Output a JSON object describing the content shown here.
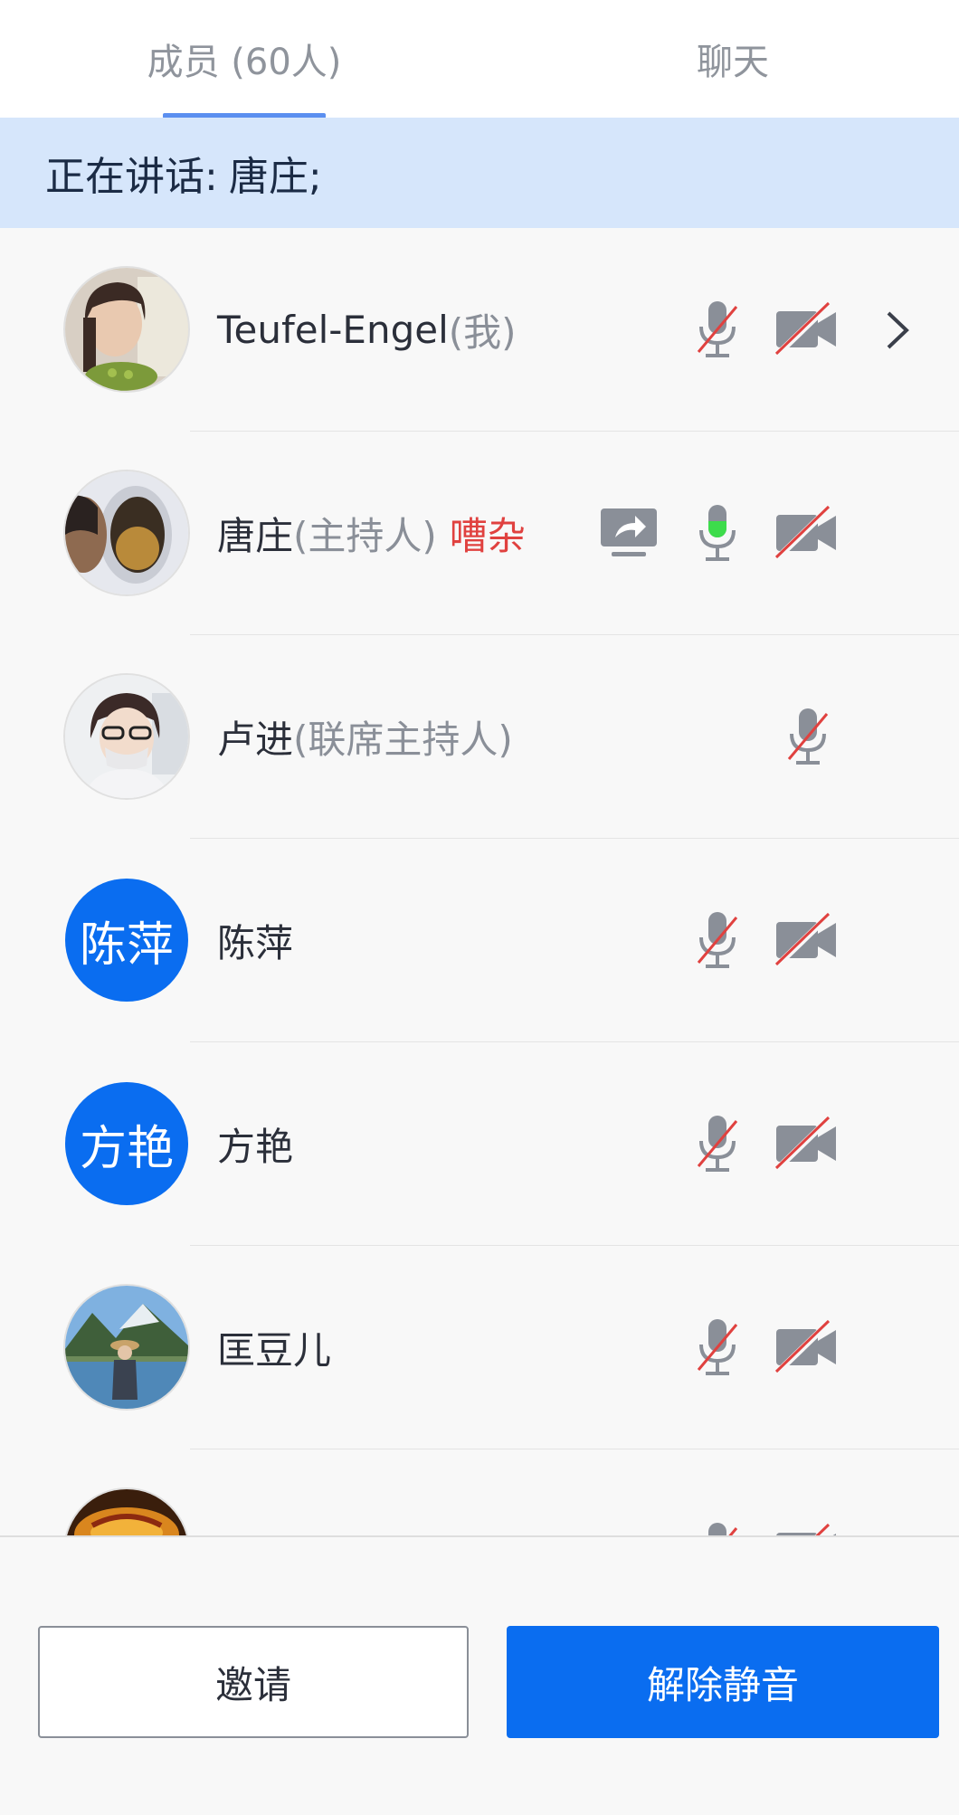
{
  "tabs": {
    "members": "成员 (60人)",
    "chat": "聊天"
  },
  "speaking": {
    "label": "正在讲话:",
    "names": "唐庄;"
  },
  "members": [
    {
      "name": "Teufel-Engel",
      "role": "(我)",
      "avatar": "photo-woman",
      "icons": [
        "mic-muted-icon",
        "camera-off-icon",
        "chevron-right-icon"
      ]
    },
    {
      "name": "唐庄",
      "role": "(主持人)",
      "noisy": "嘈杂",
      "avatar": "photo-plane-window",
      "icons": [
        "screen-share-icon",
        "mic-active-icon",
        "camera-off-icon"
      ]
    },
    {
      "name": "卢进",
      "role": "(联席主持人)",
      "avatar": "photo-woman-glasses",
      "icons": [
        "mic-muted-icon"
      ]
    },
    {
      "name": "陈萍",
      "avatar_text": "陈萍",
      "avatar": "text",
      "icons": [
        "mic-muted-icon",
        "camera-off-icon"
      ]
    },
    {
      "name": "方艳",
      "avatar_text": "方艳",
      "avatar": "text",
      "icons": [
        "mic-muted-icon",
        "camera-off-icon"
      ]
    },
    {
      "name": "匡豆儿",
      "avatar": "photo-lake",
      "icons": [
        "mic-muted-icon",
        "camera-off-icon"
      ]
    },
    {
      "name": "",
      "avatar": "photo-orange",
      "icons": [
        "mic-muted-icon",
        "camera-off-icon"
      ]
    }
  ],
  "buttons": {
    "invite": "邀请",
    "unmute": "解除静音"
  },
  "colors": {
    "accent": "#0a6df0",
    "speaking_bg": "#d6e6fb",
    "noisy": "#e0413f",
    "mic_active": "#3ddc4b",
    "muted_slash": "#e0413f"
  }
}
